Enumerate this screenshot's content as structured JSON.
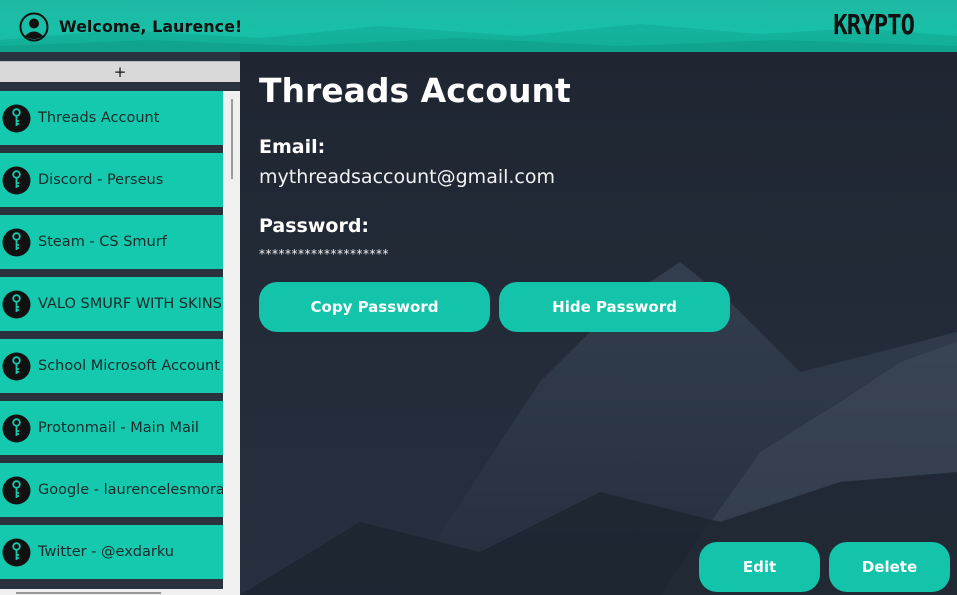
{
  "header": {
    "welcome": "Welcome, Laurence!",
    "brand": "KRYPTO",
    "icons": {
      "avatar": "user-avatar-icon"
    }
  },
  "sidebar": {
    "add_label": "+",
    "item_icon": "key-icon",
    "items": [
      {
        "label": "Threads Account"
      },
      {
        "label": "Discord - Perseus"
      },
      {
        "label": "Steam - CS Smurf"
      },
      {
        "label": "VALO SMURF WITH SKINS"
      },
      {
        "label": "School Microsoft Account"
      },
      {
        "label": "Protonmail - Main Mail"
      },
      {
        "label": "Google - laurencelesmoras"
      },
      {
        "label": "Twitter - @exdarku"
      }
    ]
  },
  "main": {
    "title": "Threads Account",
    "email_label": "Email:",
    "email_value": "mythreadsaccount@gmail.com",
    "password_label": "Password:",
    "password_value": "********************",
    "copy_button": "Copy Password",
    "hide_button": "Hide Password",
    "edit_button": "Edit",
    "delete_button": "Delete"
  },
  "colors": {
    "accent": "#14c4aa",
    "header": "#19c0a8",
    "background": "#232a36",
    "text_dark": "#111111"
  }
}
